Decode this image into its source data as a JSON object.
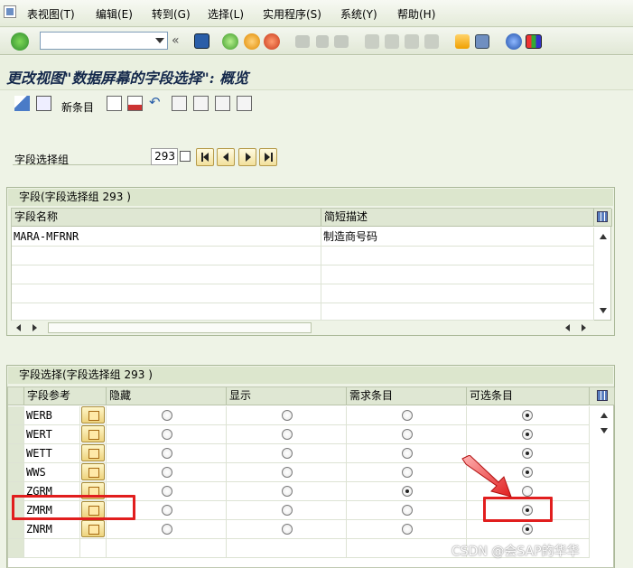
{
  "menubar": {
    "items": [
      "表视图(T)",
      "编辑(E)",
      "转到(G)",
      "选择(L)",
      "实用程序(S)",
      "系统(Y)",
      "帮助(H)"
    ]
  },
  "toolbar": {
    "command_field_value": "",
    "icons": [
      "enter-icon",
      "save-icon",
      "back-icon",
      "exit-icon",
      "cancel-icon",
      "print-icon",
      "find-icon",
      "find-next-icon",
      "first-page-icon",
      "prev-page-icon",
      "next-page-icon",
      "last-page-icon",
      "create-session-icon",
      "shortcut-icon",
      "help-icon",
      "customize-layout-icon"
    ]
  },
  "title": {
    "text": "更改视图\"数据屏幕的字段选择\": 概览"
  },
  "app_toolbar": {
    "new_entries_label": "新条目"
  },
  "group_selection": {
    "label": "字段选择组",
    "value": "293"
  },
  "fields_panel": {
    "title": "字段(字段选择组 293 )",
    "columns": [
      "字段名称",
      "简短描述"
    ],
    "rows": [
      {
        "name": "MARA-MFRNR",
        "desc": "制造商号码"
      }
    ]
  },
  "selection_panel": {
    "title": "字段选择(字段选择组 293 )",
    "columns": [
      "字段参考",
      "隐藏",
      "显示",
      "需求条目",
      "可选条目"
    ],
    "rows": [
      {
        "ref": "WERB",
        "selected": 3
      },
      {
        "ref": "WERT",
        "selected": 3
      },
      {
        "ref": "WETT",
        "selected": 3
      },
      {
        "ref": "WWS",
        "selected": 3
      },
      {
        "ref": "ZGRM",
        "selected": 2
      },
      {
        "ref": "ZMRM",
        "selected": 3
      },
      {
        "ref": "ZNRM",
        "selected": 3
      }
    ]
  },
  "watermark": "CSDN @会SAP的华华",
  "colors": {
    "highlight": "#e11e1e",
    "title_text": "#14284b",
    "background": "#eef3e6"
  }
}
